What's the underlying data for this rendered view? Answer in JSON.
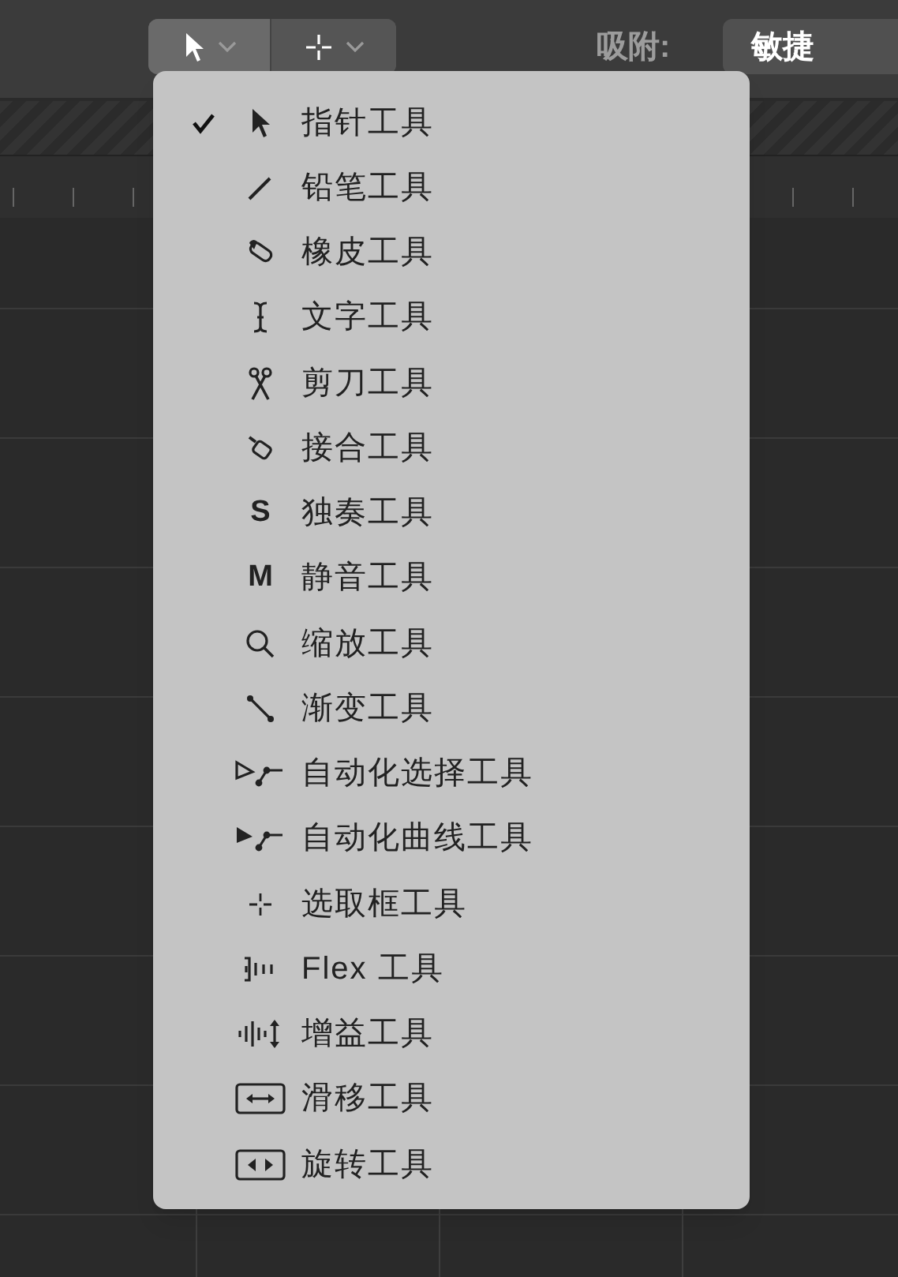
{
  "toolbar": {
    "tool_buttons": [
      {
        "selected": true
      },
      {
        "selected": false
      }
    ],
    "snap_label": "吸附:",
    "snap_value": "敏捷"
  },
  "tool_menu": {
    "items": [
      {
        "label": "指针工具",
        "selected": true
      },
      {
        "label": "铅笔工具",
        "selected": false
      },
      {
        "label": "橡皮工具",
        "selected": false
      },
      {
        "label": "文字工具",
        "selected": false
      },
      {
        "label": "剪刀工具",
        "selected": false
      },
      {
        "label": "接合工具",
        "selected": false
      },
      {
        "label": "独奏工具",
        "selected": false,
        "glyph": "S"
      },
      {
        "label": "静音工具",
        "selected": false,
        "glyph": "M"
      },
      {
        "label": "缩放工具",
        "selected": false
      },
      {
        "label": "渐变工具",
        "selected": false
      },
      {
        "label": "自动化选择工具",
        "selected": false
      },
      {
        "label": "自动化曲线工具",
        "selected": false
      },
      {
        "label": "选取框工具",
        "selected": false
      },
      {
        "label": "Flex 工具",
        "selected": false
      },
      {
        "label": "增益工具",
        "selected": false
      },
      {
        "label": "滑移工具",
        "selected": false
      },
      {
        "label": "旋转工具",
        "selected": false
      }
    ]
  }
}
